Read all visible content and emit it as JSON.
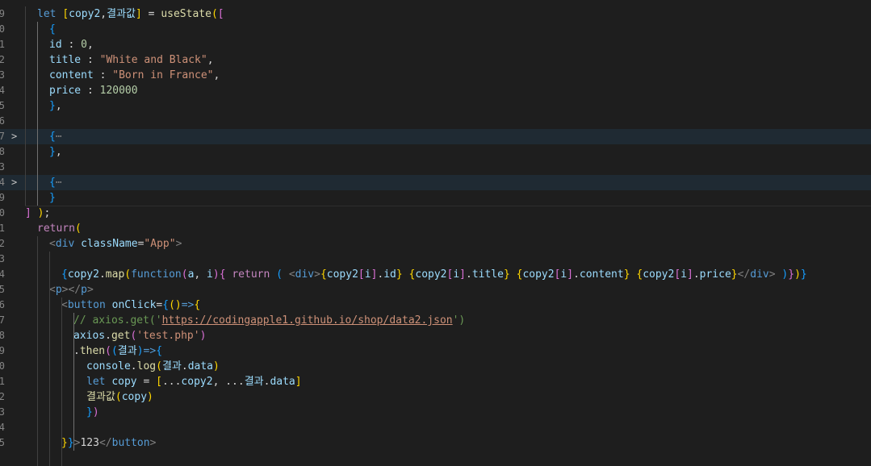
{
  "editor": {
    "gutter": [
      "9",
      "0",
      "1",
      "2",
      "3",
      "4",
      "5",
      "6",
      "7",
      "8",
      "9",
      "0",
      "1",
      "2",
      "3",
      "4",
      "5",
      "6",
      "7",
      "8",
      "9",
      "0",
      "1",
      "2",
      "3",
      "4",
      "5",
      "6",
      "7",
      "8",
      "9"
    ],
    "lines": [
      {
        "ln": "9",
        "fold": "",
        "hl": false,
        "indent": 1,
        "tokens": [
          [
            "kw",
            "let "
          ],
          [
            "b1",
            "["
          ],
          [
            "var",
            "copy2"
          ],
          [
            "txt",
            ","
          ],
          [
            "var",
            "결과값"
          ],
          [
            "b1",
            "]"
          ],
          [
            "txt",
            " = "
          ],
          [
            "fn",
            "useState"
          ],
          [
            "b1",
            "("
          ],
          [
            "b2",
            "["
          ]
        ]
      },
      {
        "ln": "0",
        "fold": "",
        "hl": false,
        "indent": 2,
        "tokens": [
          [
            "b3",
            "{"
          ]
        ]
      },
      {
        "ln": "1",
        "fold": "",
        "hl": false,
        "indent": 2,
        "tokens": [
          [
            "var",
            "id"
          ],
          [
            "txt",
            " : "
          ],
          [
            "num",
            "0"
          ],
          [
            "txt",
            ","
          ]
        ]
      },
      {
        "ln": "2",
        "fold": "",
        "hl": false,
        "indent": 2,
        "tokens": [
          [
            "var",
            "title"
          ],
          [
            "txt",
            " : "
          ],
          [
            "str",
            "\"White and Black\""
          ],
          [
            "txt",
            ","
          ]
        ]
      },
      {
        "ln": "3",
        "fold": "",
        "hl": false,
        "indent": 2,
        "tokens": [
          [
            "var",
            "content"
          ],
          [
            "txt",
            " : "
          ],
          [
            "str",
            "\"Born in France\""
          ],
          [
            "txt",
            ","
          ]
        ]
      },
      {
        "ln": "4",
        "fold": "",
        "hl": false,
        "indent": 2,
        "tokens": [
          [
            "var",
            "price"
          ],
          [
            "txt",
            " : "
          ],
          [
            "num",
            "120000"
          ]
        ]
      },
      {
        "ln": "5",
        "fold": "",
        "hl": false,
        "indent": 2,
        "tokens": [
          [
            "b3",
            "}"
          ],
          [
            "txt",
            ","
          ]
        ]
      },
      {
        "ln": "6",
        "fold": "",
        "hl": false,
        "indent": 2,
        "tokens": []
      },
      {
        "ln": "7",
        "fold": ">",
        "hl": true,
        "indent": 2,
        "tokens": [
          [
            "b3",
            "{"
          ],
          [
            "ell",
            "⋯"
          ]
        ]
      },
      {
        "ln": "8",
        "fold": "",
        "hl": false,
        "indent": 2,
        "tokens": [
          [
            "b3",
            "}"
          ],
          [
            "txt",
            ","
          ]
        ]
      },
      {
        "ln": "3",
        "fold": "",
        "hl": false,
        "indent": 2,
        "tokens": []
      },
      {
        "ln": "4",
        "fold": ">",
        "hl": true,
        "indent": 2,
        "tokens": [
          [
            "b3",
            "{"
          ],
          [
            "ell",
            "⋯"
          ]
        ]
      },
      {
        "ln": "9",
        "fold": "",
        "hl": false,
        "indent": 2,
        "tokens": [
          [
            "b3",
            "}"
          ]
        ]
      },
      {
        "ln": "0",
        "fold": "",
        "hl": false,
        "indent": 0,
        "tokens": [
          [
            "b2",
            "]"
          ],
          [
            "txt",
            " "
          ],
          [
            "b1",
            ")"
          ],
          [
            "txt",
            ";"
          ]
        ]
      },
      {
        "ln": "1",
        "fold": "",
        "hl": false,
        "indent": 1,
        "tokens": [
          [
            "ctrl",
            "return"
          ],
          [
            "b1",
            "("
          ]
        ]
      },
      {
        "ln": "2",
        "fold": "",
        "hl": false,
        "indent": 2,
        "tokens": [
          [
            "ang",
            "<"
          ],
          [
            "tag",
            "div"
          ],
          [
            "txt",
            " "
          ],
          [
            "attr",
            "className"
          ],
          [
            "txt",
            "="
          ],
          [
            "str",
            "\"App\""
          ],
          [
            "ang",
            ">"
          ]
        ]
      },
      {
        "ln": "3",
        "fold": "",
        "hl": false,
        "indent": 3,
        "tokens": []
      },
      {
        "ln": "4",
        "fold": "",
        "hl": false,
        "indent": 3,
        "tokens": [
          [
            "b3",
            "{"
          ],
          [
            "var",
            "copy2"
          ],
          [
            "txt",
            "."
          ],
          [
            "fn",
            "map"
          ],
          [
            "b1",
            "("
          ],
          [
            "kw",
            "function"
          ],
          [
            "b2",
            "("
          ],
          [
            "var",
            "a"
          ],
          [
            "txt",
            ", "
          ],
          [
            "var",
            "i"
          ],
          [
            "b2",
            ")"
          ],
          [
            "b2",
            "{"
          ],
          [
            "txt",
            " "
          ],
          [
            "ctrl",
            "return"
          ],
          [
            "txt",
            " "
          ],
          [
            "b3",
            "("
          ],
          [
            "txt",
            " "
          ],
          [
            "ang",
            "<"
          ],
          [
            "tag",
            "div"
          ],
          [
            "ang",
            ">"
          ],
          [
            "b1",
            "{"
          ],
          [
            "var",
            "copy2"
          ],
          [
            "b2",
            "["
          ],
          [
            "var",
            "i"
          ],
          [
            "b2",
            "]"
          ],
          [
            "txt",
            "."
          ],
          [
            "var",
            "id"
          ],
          [
            "b1",
            "}"
          ],
          [
            "txt",
            " "
          ],
          [
            "b1",
            "{"
          ],
          [
            "var",
            "copy2"
          ],
          [
            "b2",
            "["
          ],
          [
            "var",
            "i"
          ],
          [
            "b2",
            "]"
          ],
          [
            "txt",
            "."
          ],
          [
            "var",
            "title"
          ],
          [
            "b1",
            "}"
          ],
          [
            "txt",
            " "
          ],
          [
            "b1",
            "{"
          ],
          [
            "var",
            "copy2"
          ],
          [
            "b2",
            "["
          ],
          [
            "var",
            "i"
          ],
          [
            "b2",
            "]"
          ],
          [
            "txt",
            "."
          ],
          [
            "var",
            "content"
          ],
          [
            "b1",
            "}"
          ],
          [
            "txt",
            " "
          ],
          [
            "b1",
            "{"
          ],
          [
            "var",
            "copy2"
          ],
          [
            "b2",
            "["
          ],
          [
            "var",
            "i"
          ],
          [
            "b2",
            "]"
          ],
          [
            "txt",
            "."
          ],
          [
            "var",
            "price"
          ],
          [
            "b1",
            "}"
          ],
          [
            "ang",
            "</"
          ],
          [
            "tag",
            "div"
          ],
          [
            "ang",
            ">"
          ],
          [
            "txt",
            " "
          ],
          [
            "b3",
            ")"
          ],
          [
            "b2",
            "}"
          ],
          [
            "b1",
            ")"
          ],
          [
            "b3",
            "}"
          ]
        ]
      },
      {
        "ln": "5",
        "fold": "",
        "hl": false,
        "indent": 2,
        "tokens": [
          [
            "ang",
            "<"
          ],
          [
            "tag",
            "p"
          ],
          [
            "ang",
            "></"
          ],
          [
            "tag",
            "p"
          ],
          [
            "ang",
            ">"
          ]
        ]
      },
      {
        "ln": "6",
        "fold": "",
        "hl": false,
        "indent": 3,
        "tokens": [
          [
            "ang",
            "<"
          ],
          [
            "tag",
            "button"
          ],
          [
            "txt",
            " "
          ],
          [
            "attr",
            "onClick"
          ],
          [
            "txt",
            "="
          ],
          [
            "b3",
            "{"
          ],
          [
            "b1",
            "("
          ],
          [
            "b1",
            ")"
          ],
          [
            "kw",
            "=>"
          ],
          [
            "b1",
            "{"
          ]
        ]
      },
      {
        "ln": "7",
        "fold": "",
        "hl": false,
        "indent": 4,
        "tokens": [
          [
            "cmt",
            "// axios.get('"
          ],
          [
            "url",
            "https://codingapple1.github.io/shop/data2.json"
          ],
          [
            "cmt",
            "')"
          ]
        ]
      },
      {
        "ln": "8",
        "fold": "",
        "hl": false,
        "indent": 4,
        "tokens": [
          [
            "var",
            "axios"
          ],
          [
            "txt",
            "."
          ],
          [
            "fn",
            "get"
          ],
          [
            "b2",
            "("
          ],
          [
            "str",
            "'test.php'"
          ],
          [
            "b2",
            ")"
          ]
        ]
      },
      {
        "ln": "9",
        "fold": "",
        "hl": false,
        "indent": 4,
        "tokens": [
          [
            "txt",
            "."
          ],
          [
            "fn",
            "then"
          ],
          [
            "b2",
            "("
          ],
          [
            "b3",
            "("
          ],
          [
            "var",
            "결과"
          ],
          [
            "b3",
            ")"
          ],
          [
            "kw",
            "=>"
          ],
          [
            "b3",
            "{"
          ]
        ]
      },
      {
        "ln": "0",
        "fold": "",
        "hl": false,
        "indent": 5,
        "tokens": [
          [
            "var",
            "console"
          ],
          [
            "txt",
            "."
          ],
          [
            "fn",
            "log"
          ],
          [
            "b1",
            "("
          ],
          [
            "var",
            "결과"
          ],
          [
            "txt",
            "."
          ],
          [
            "var",
            "data"
          ],
          [
            "b1",
            ")"
          ]
        ]
      },
      {
        "ln": "1",
        "fold": "",
        "hl": false,
        "indent": 5,
        "tokens": [
          [
            "kw",
            "let "
          ],
          [
            "var",
            "copy"
          ],
          [
            "txt",
            " = "
          ],
          [
            "b1",
            "["
          ],
          [
            "txt",
            "..."
          ],
          [
            "var",
            "copy2"
          ],
          [
            "txt",
            ", ..."
          ],
          [
            "var",
            "결과"
          ],
          [
            "txt",
            "."
          ],
          [
            "var",
            "data"
          ],
          [
            "b1",
            "]"
          ]
        ]
      },
      {
        "ln": "2",
        "fold": "",
        "hl": false,
        "indent": 5,
        "tokens": [
          [
            "fn",
            "결과값"
          ],
          [
            "b1",
            "("
          ],
          [
            "var",
            "copy"
          ],
          [
            "b1",
            ")"
          ]
        ]
      },
      {
        "ln": "3",
        "fold": "",
        "hl": false,
        "indent": 5,
        "tokens": [
          [
            "b3",
            "}"
          ],
          [
            "b2",
            ")"
          ]
        ]
      },
      {
        "ln": "4",
        "fold": "",
        "hl": false,
        "indent": 4,
        "tokens": []
      },
      {
        "ln": "5",
        "fold": "",
        "hl": false,
        "indent": 3,
        "tokens": [
          [
            "b1",
            "}"
          ],
          [
            "b3",
            "}"
          ],
          [
            "ang",
            ">"
          ],
          [
            "txt",
            "123"
          ],
          [
            "ang",
            "</"
          ],
          [
            "tag",
            "button"
          ],
          [
            "ang",
            ">"
          ]
        ]
      }
    ]
  }
}
